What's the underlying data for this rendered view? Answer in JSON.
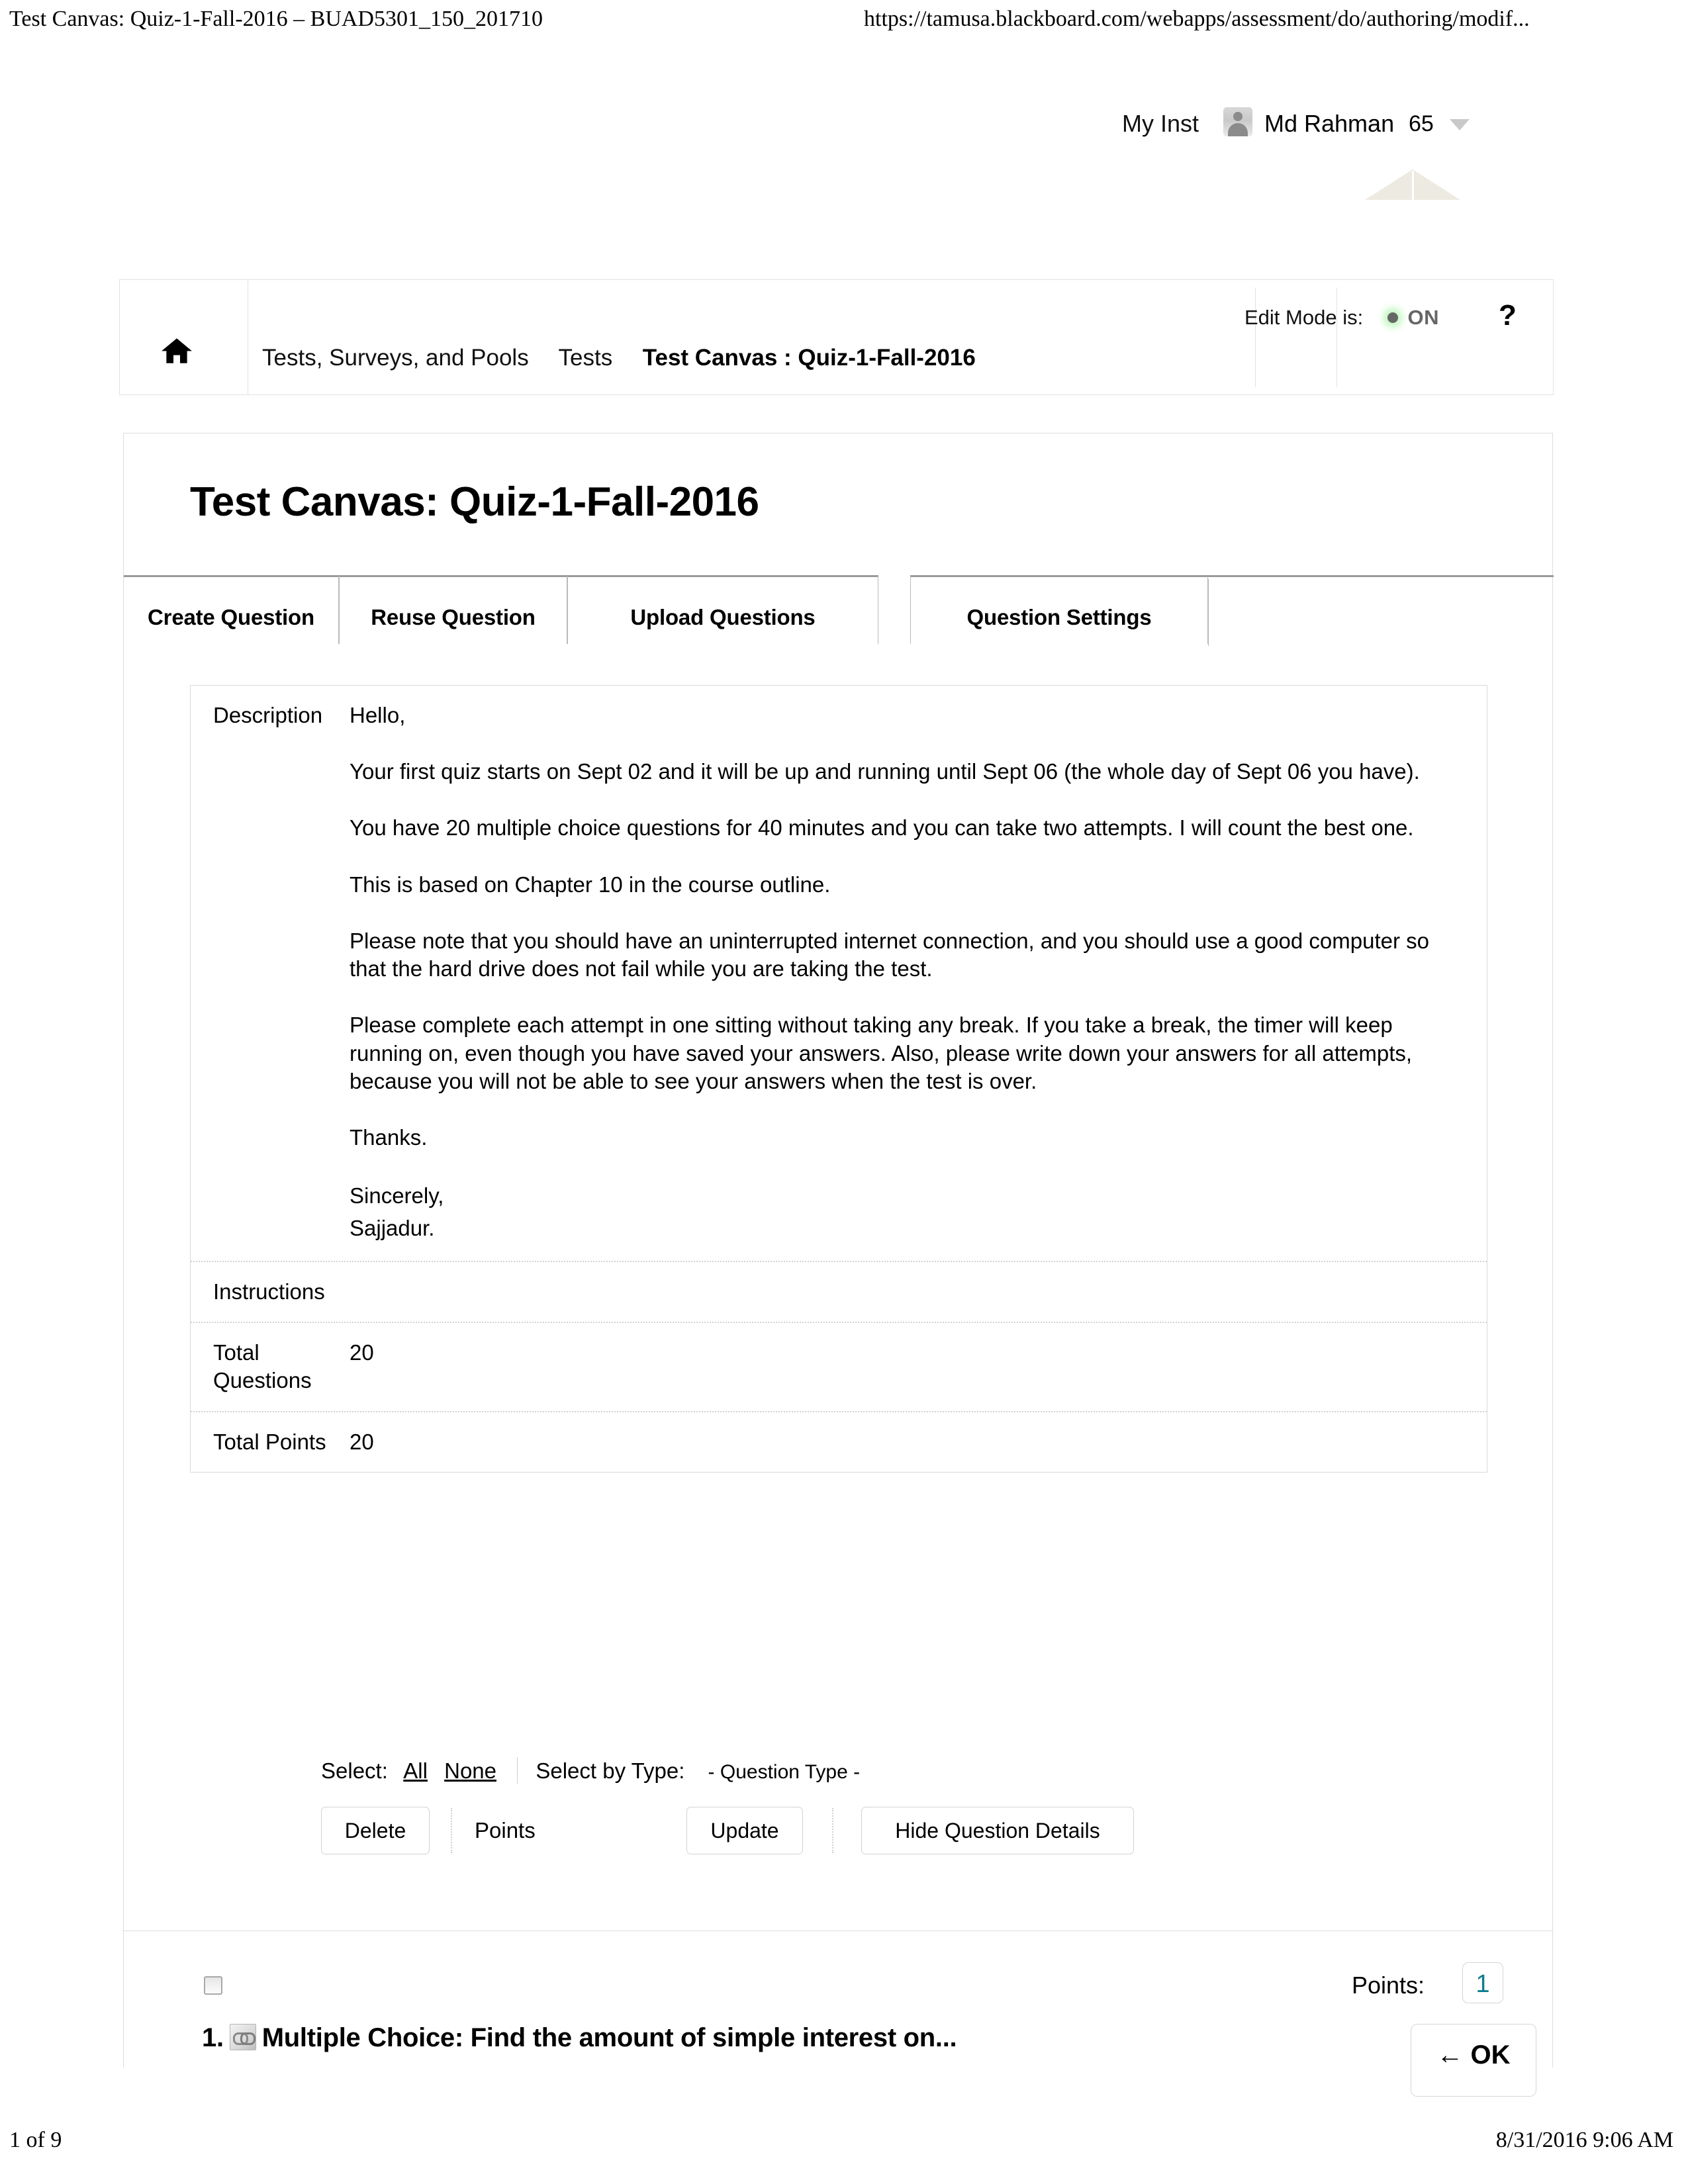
{
  "print": {
    "header_left": "Test Canvas: Quiz-1-Fall-2016 – BUAD5301_150_201710",
    "header_right": "https://tamusa.blackboard.com/webapps/assessment/do/authoring/modif...",
    "footer_left": "1 of 9",
    "footer_right": "8/31/2016 9:06 AM"
  },
  "userbar": {
    "my_institution": "My Inst",
    "user_name": "Md Rahman",
    "count": "65",
    "avatar_icon": "user-avatar-icon",
    "caret_icon": "chevron-down-icon"
  },
  "breadcrumb": {
    "home_icon": "home-icon",
    "items": [
      {
        "label": "Tests, Surveys, and Pools",
        "current": false
      },
      {
        "label": "Tests",
        "current": false
      },
      {
        "label": "Test Canvas : Quiz-1-Fall-2016",
        "current": true
      }
    ]
  },
  "edit_mode": {
    "label": "Edit Mode is:",
    "state": "ON",
    "dot_color": "#666666",
    "glow_color": "#96f096",
    "help_icon": "question-mark-help-icon"
  },
  "page": {
    "title": "Test Canvas: Quiz-1-Fall-2016"
  },
  "tabs": [
    {
      "label": "Create Question"
    },
    {
      "label": "Reuse Question"
    },
    {
      "label": "Upload Questions"
    },
    {
      "label": "Question Settings"
    }
  ],
  "description": {
    "label": "Description",
    "paragraphs": [
      "Hello,",
      "Your first quiz  starts on Sept 02 and it will be up and running until Sept 06 (the whole day of Sept 06 you have).",
      "You have 20 multiple choice questions for 40 minutes and you can take two attempts. I will count the best one.",
      "This is based on Chapter 10 in the course outline.",
      "Please note that you should have an uninterrupted internet connection, and you should use a good computer so that the hard drive does not fail while you are taking the test.",
      "Please complete each attempt in one sitting without taking any break. If you take a break, the timer will keep running on, even though you have saved your answers. Also, please write down your answers for all attempts, because you will not be able to see your answers when the test is over.",
      "Thanks."
    ],
    "signoff_line_1": "Sincerely,",
    "signoff_line_2": "Sajjadur.",
    "rows": [
      {
        "label": "Instructions",
        "value": ""
      },
      {
        "label": "Total Questions",
        "value": "20"
      },
      {
        "label": "Total Points",
        "value": "20"
      }
    ]
  },
  "toolbar": {
    "select_label": "Select:",
    "select_all": "All",
    "select_none": "None",
    "select_by_type_label": "Select by Type:",
    "question_type_value": "- Question Type -",
    "delete_label": "Delete",
    "points_label": "Points",
    "update_label": "Update",
    "hide_details_label": "Hide Question Details"
  },
  "question": {
    "number": "1.",
    "type_icon": "question-type-icon",
    "title": "Multiple Choice: Find the amount of simple interest on...",
    "points_label": "Points:",
    "points_value": "1",
    "points_value_color": "#0d7c8e",
    "ok_label": "← OK"
  }
}
